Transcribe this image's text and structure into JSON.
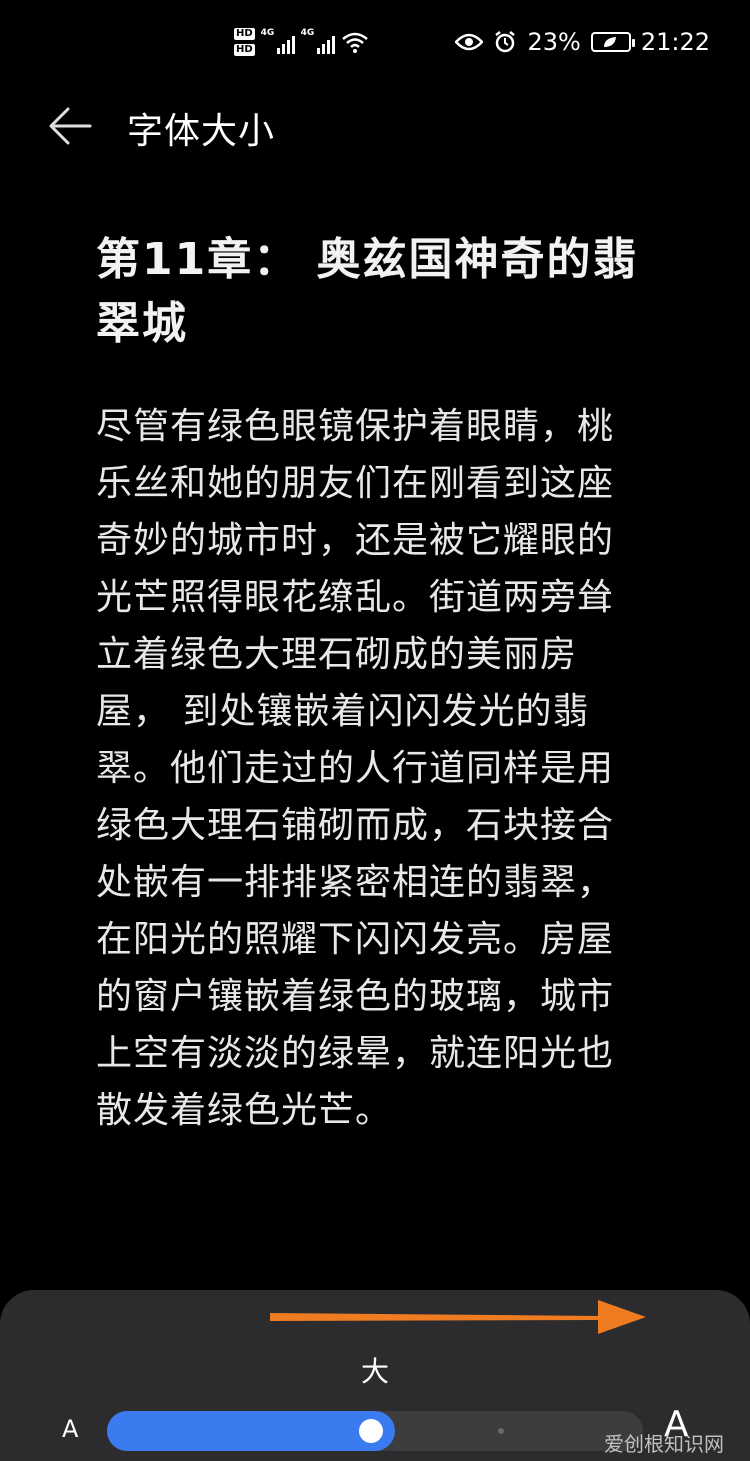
{
  "status_bar": {
    "hd1": "HD",
    "hd2": "HD",
    "net1": "4G",
    "net2": "4G",
    "battery": "23%",
    "time": "21:22",
    "icons": [
      "signal-icon",
      "wifi-icon",
      "eye-icon",
      "alarm-icon",
      "battery-icon"
    ]
  },
  "header": {
    "title": "字体大小",
    "back_icon": "back-arrow-icon"
  },
  "preview": {
    "chapter_title": "第11章： 奥兹国神奇的翡翠城",
    "body": "尽管有绿色眼镜保护着眼睛，桃乐丝和她的朋友们在刚看到这座奇妙的城市时，还是被它耀眼的光芒照得眼花缭乱。街道两旁耸立着绿色大理石砌成的美丽房屋， 到处镶嵌着闪闪发光的翡翠。他们走过的人行道同样是用绿色大理石铺砌而成，石块接合处嵌有一排排紧密相连的翡翠，在阳光的照耀下闪闪发亮。房屋的窗户镶嵌着绿色的玻璃，城市上空有淡淡的绿晕，就连阳光也散发着绿色光芒。"
  },
  "font_size_control": {
    "current_label": "大",
    "small_label": "A",
    "large_label": "A",
    "level": 0.5,
    "accent_color": "#3a7cf0",
    "annotation_color": "#f07c22"
  },
  "watermark": "爱创根知识网"
}
